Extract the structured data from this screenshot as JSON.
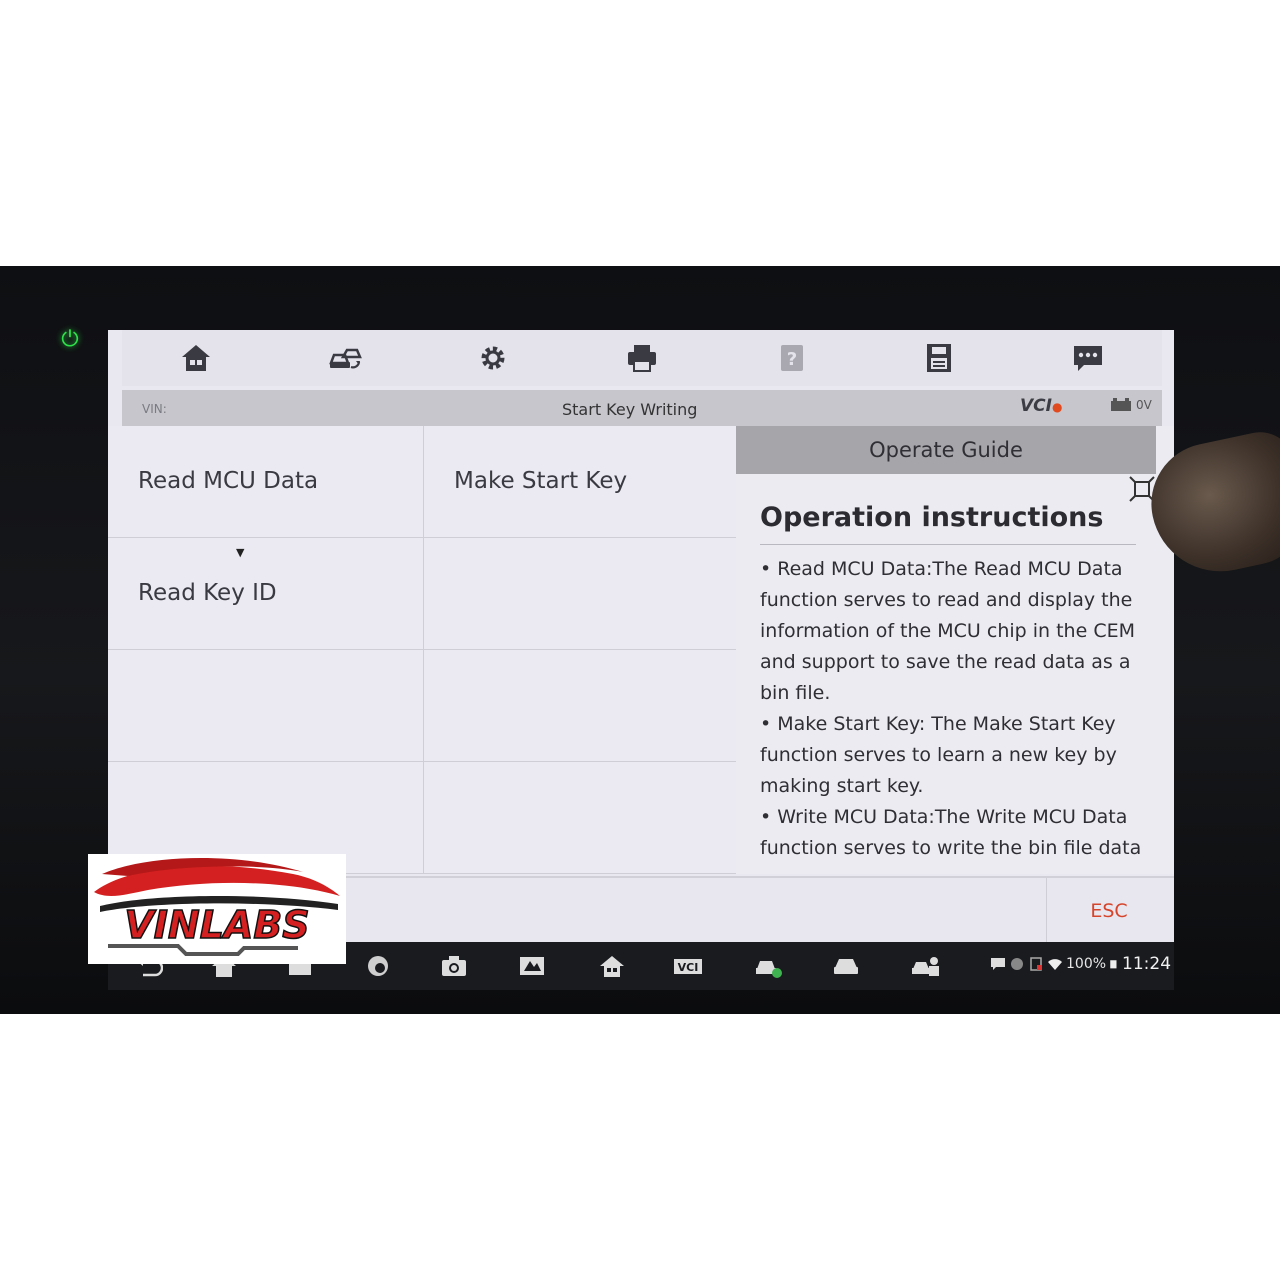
{
  "device": {
    "power_icon": "power-icon"
  },
  "toolbar": {
    "buttons": [
      {
        "name": "home-icon"
      },
      {
        "name": "vehicle-swap-icon"
      },
      {
        "name": "settings-icon"
      },
      {
        "name": "print-icon"
      },
      {
        "name": "help-icon"
      },
      {
        "name": "save-icon"
      },
      {
        "name": "data-logging-icon"
      }
    ]
  },
  "vin_bar": {
    "vin_label": "VIN:",
    "title": "Start Key Writing",
    "vci_label": "VCI",
    "battery_text": "0V"
  },
  "functions": {
    "items": [
      {
        "label": "Read MCU Data"
      },
      {
        "label": "Make Start Key"
      },
      {
        "label": "Read Key ID"
      },
      {
        "label": ""
      },
      {
        "label": ""
      },
      {
        "label": ""
      },
      {
        "label": ""
      },
      {
        "label": ""
      }
    ]
  },
  "guide": {
    "header": "Operate Guide",
    "title": "Operation instructions",
    "paragraphs": [
      "• Read MCU Data:The Read MCU Data function serves to read and display the information of the MCU chip in the CEM and support to save the read data as a bin file.",
      "• Make Start Key: The Make Start Key function serves to learn a new key by making start key.",
      "• Write MCU Data:The Write MCU Data function serves to write the bin file data"
    ]
  },
  "action_bar": {
    "esc_label": "ESC"
  },
  "navbar": {
    "vci_text": "VCI",
    "battery_percent": "100%",
    "clock": "11:24"
  },
  "logo": {
    "text": "VINLABS"
  },
  "colors": {
    "accent_red": "#d6452b",
    "led_green": "#2ee04a"
  }
}
